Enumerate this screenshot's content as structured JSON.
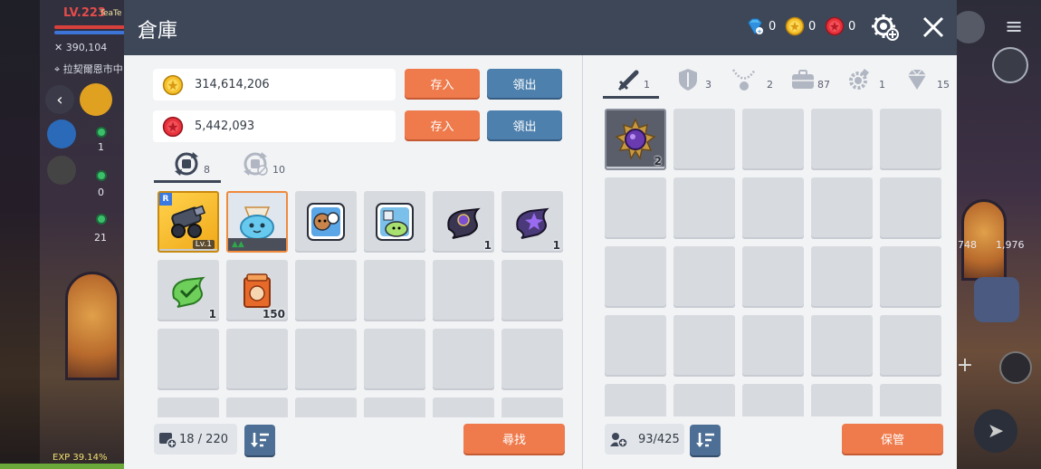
{
  "hud": {
    "level": "LV.223",
    "player_name": "TeaTe",
    "combat_power": "390,104",
    "location": "拉契爾恩市中",
    "exp": "EXP 39.14%",
    "left_nums": [
      "1",
      "0",
      "21"
    ],
    "right_nums": [
      "748",
      "1,976"
    ]
  },
  "header": {
    "title": "倉庫",
    "currencies": [
      {
        "icon": "blue-gem-icon",
        "value": "0"
      },
      {
        "icon": "gold-coin-icon",
        "value": "0"
      },
      {
        "icon": "red-coin-icon",
        "value": "0"
      }
    ]
  },
  "money": {
    "meso": {
      "value": "314,614,206",
      "deposit": "存入",
      "withdraw": "領出"
    },
    "red": {
      "value": "5,442,093",
      "deposit": "存入",
      "withdraw": "領出"
    }
  },
  "left_tabs": [
    {
      "count": "8"
    },
    {
      "count": "10"
    }
  ],
  "left_items": [
    {
      "name": "cannon-item",
      "qty": "",
      "lv": "Lv.1",
      "rare": "R"
    },
    {
      "name": "slime-pet-item",
      "qty": "",
      "lv": "",
      "rare": ""
    },
    {
      "name": "dog-card-item",
      "qty": "",
      "lv": "",
      "rare": ""
    },
    {
      "name": "slime-card-item",
      "qty": "",
      "lv": "",
      "rare": ""
    },
    {
      "name": "dark-scroll-item",
      "qty": "1",
      "lv": "",
      "rare": ""
    },
    {
      "name": "purple-scroll-item",
      "qty": "1",
      "lv": "",
      "rare": ""
    },
    {
      "name": "green-scroll-item",
      "qty": "1",
      "lv": "",
      "rare": ""
    },
    {
      "name": "pouch-item",
      "qty": "150",
      "lv": "",
      "rare": ""
    }
  ],
  "left_footer": {
    "capacity": "18 / 220",
    "search": "尋找"
  },
  "right_tabs": [
    {
      "icon": "sword-icon",
      "count": "1"
    },
    {
      "icon": "shield-icon",
      "count": "3"
    },
    {
      "icon": "necklace-icon",
      "count": "2"
    },
    {
      "icon": "briefcase-icon",
      "count": "87"
    },
    {
      "icon": "cog-gem-icon",
      "count": "1"
    },
    {
      "icon": "diamond-icon",
      "count": "15"
    }
  ],
  "right_items": [
    {
      "name": "purple-gem-item",
      "qty": "2"
    }
  ],
  "right_footer": {
    "capacity": "93/425",
    "store": "保管"
  }
}
